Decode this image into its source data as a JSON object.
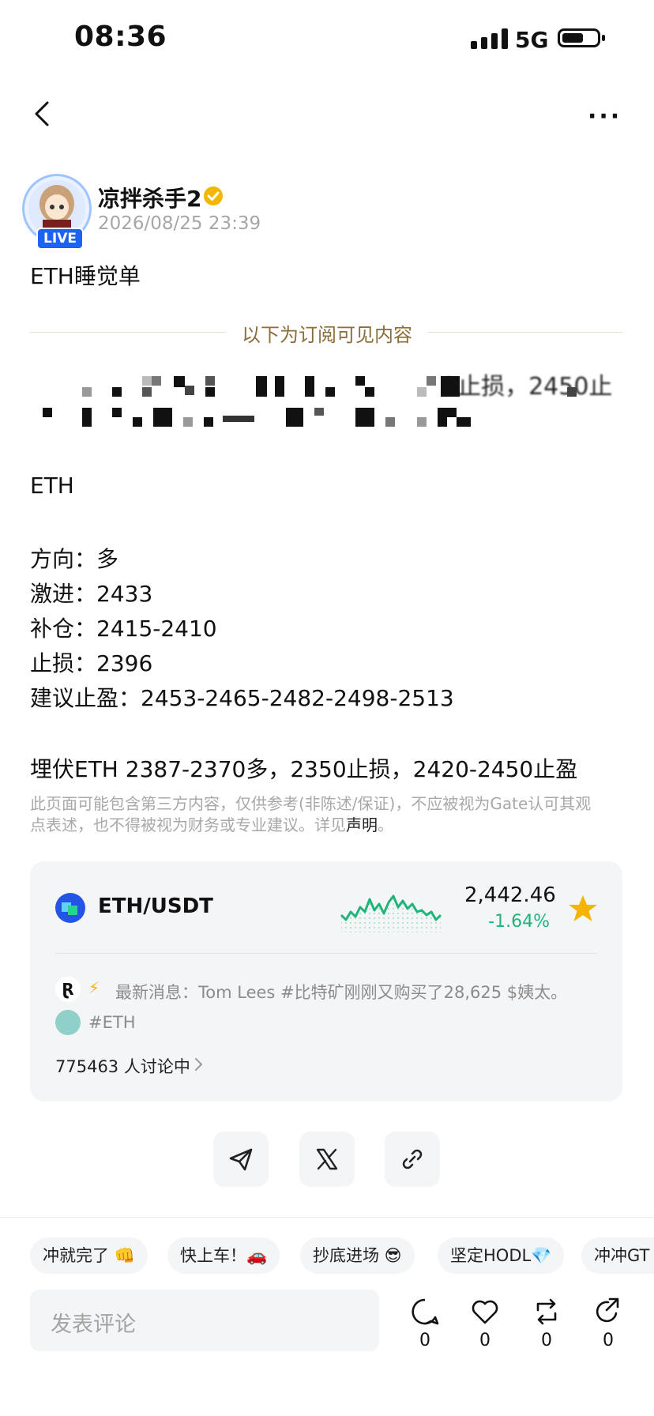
{
  "status_bar": {
    "time": "08:36",
    "network": "5G"
  },
  "author": {
    "name": "凉拌杀手2",
    "time": "2026/08/25 23:39",
    "live_badge": "LIVE"
  },
  "post": {
    "title": "ETH睡觉单",
    "subscriber_divider": "以下为订阅可见内容",
    "blurred_fragment_1": "3止损，2450止",
    "lines": [
      "ETH",
      "方向：多",
      "激进：2433",
      "补仓：2415-2410",
      "止损：2396",
      "建议止盈：2453-2465-2482-2498-2513",
      "埋伏ETH 2387-2370多，2350止损，2420-2450止盈"
    ],
    "disclaimer": "此页面可能包含第三方内容，仅供参考(非陈述/保证)，不应被视为Gate认可其观点表述，也不得被视为财务或专业建议。详见",
    "disclaimer_link": "声明",
    "disclaimer_end": "。"
  },
  "market": {
    "pair": "ETH/USDT",
    "price": "2,442.46",
    "change": "-1.64%",
    "change_color": "#1fb57a",
    "news_label": "最新消息：Tom Lees #比特矿刚刚又购买了28,625 $姨太。",
    "tag": "#ETH",
    "discussion": "775463 人讨论中"
  },
  "quick_replies": [
    "冲就完了 👊",
    "快上车！🚗",
    "抄底进场 😎",
    "坚定HODL💎",
    "冲冲GT"
  ],
  "comment": {
    "placeholder": "发表评论",
    "counts": {
      "comments": "0",
      "likes": "0",
      "reposts": "0",
      "shares": "0"
    }
  },
  "icons": {
    "back": "back-chevron-icon",
    "more": "more-dots-icon",
    "verified": "verified-badge-icon",
    "favorite": "star-icon",
    "telegram": "telegram-icon",
    "x": "x-logo-icon",
    "link": "link-icon",
    "comment": "comment-icon",
    "like": "heart-icon",
    "repost": "repost-icon",
    "share": "share-icon"
  }
}
